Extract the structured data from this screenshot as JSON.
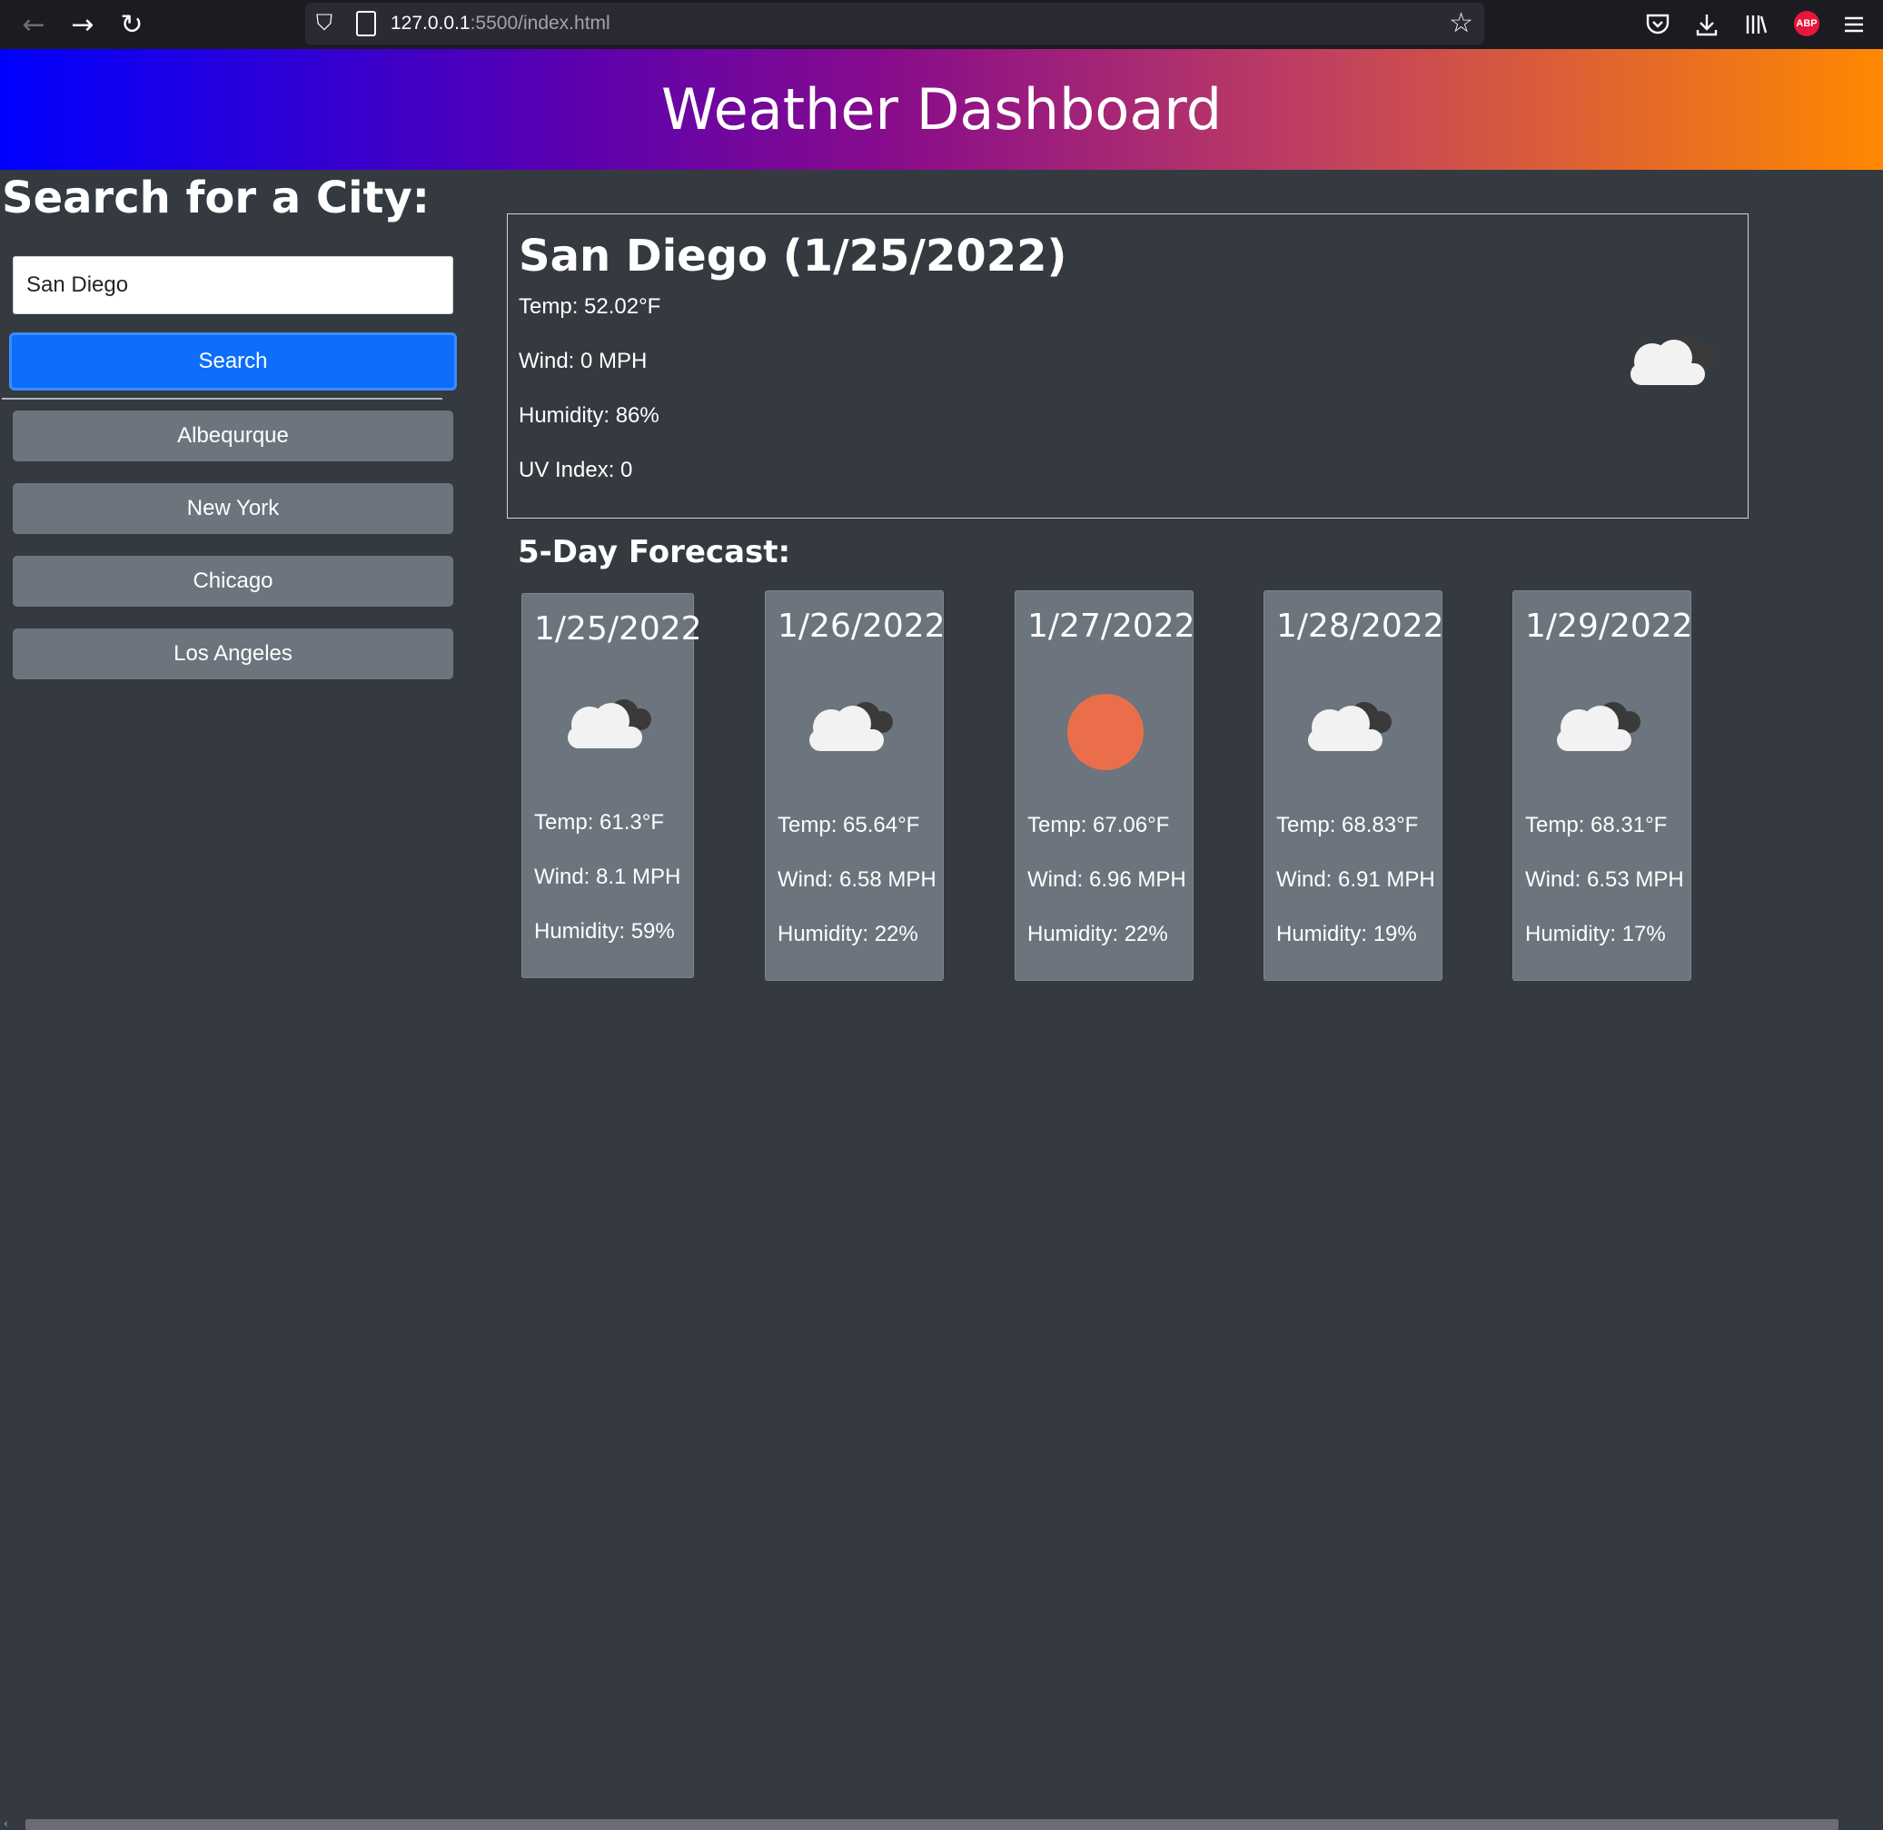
{
  "browser": {
    "url_host": "127.0.0.1",
    "url_rest": ":5500/index.html",
    "abp_label": "ABP",
    "icons": [
      "back-arrow-icon",
      "forward-arrow-icon",
      "reload-icon",
      "shield-icon",
      "page-icon",
      "star-icon",
      "pocket-icon",
      "download-icon",
      "library-icon",
      "adblock-icon",
      "menu-icon"
    ]
  },
  "header": {
    "title": "Weather Dashboard"
  },
  "sidebar": {
    "title": "Search for a City:",
    "input_value": "San Diego",
    "search_label": "Search",
    "history": [
      "Albequrque",
      "New York",
      "Chicago",
      "Los Angeles"
    ]
  },
  "current": {
    "heading": "San Diego (1/25/2022)",
    "temp": "Temp: 52.02°F",
    "wind": "Wind: 0 MPH",
    "humidity": "Humidity: 86%",
    "uv": "UV Index: 0",
    "icon": "cloudy-icon"
  },
  "forecast": {
    "title": "5-Day Forecast:",
    "days": [
      {
        "date": "1/25/2022",
        "icon": "cloudy-icon",
        "temp": "Temp: 61.3°F",
        "wind": "Wind: 8.1 MPH",
        "humidity": "Humidity: 59%"
      },
      {
        "date": "1/26/2022",
        "icon": "cloudy-icon",
        "temp": "Temp: 65.64°F",
        "wind": "Wind: 6.58 MPH",
        "humidity": "Humidity: 22%"
      },
      {
        "date": "1/27/2022",
        "icon": "sun-icon",
        "temp": "Temp: 67.06°F",
        "wind": "Wind: 6.96 MPH",
        "humidity": "Humidity: 22%"
      },
      {
        "date": "1/28/2022",
        "icon": "cloudy-icon",
        "temp": "Temp: 68.83°F",
        "wind": "Wind: 6.91 MPH",
        "humidity": "Humidity: 19%"
      },
      {
        "date": "1/29/2022",
        "icon": "cloudy-icon",
        "temp": "Temp: 68.31°F",
        "wind": "Wind: 6.53 MPH",
        "humidity": "Humidity: 17%"
      }
    ]
  },
  "colors": {
    "background": "#343a40",
    "search_button": "#0d6efd",
    "history_button": "#6c757d",
    "card": "#6c757d",
    "sun": "#eb6e4b"
  }
}
